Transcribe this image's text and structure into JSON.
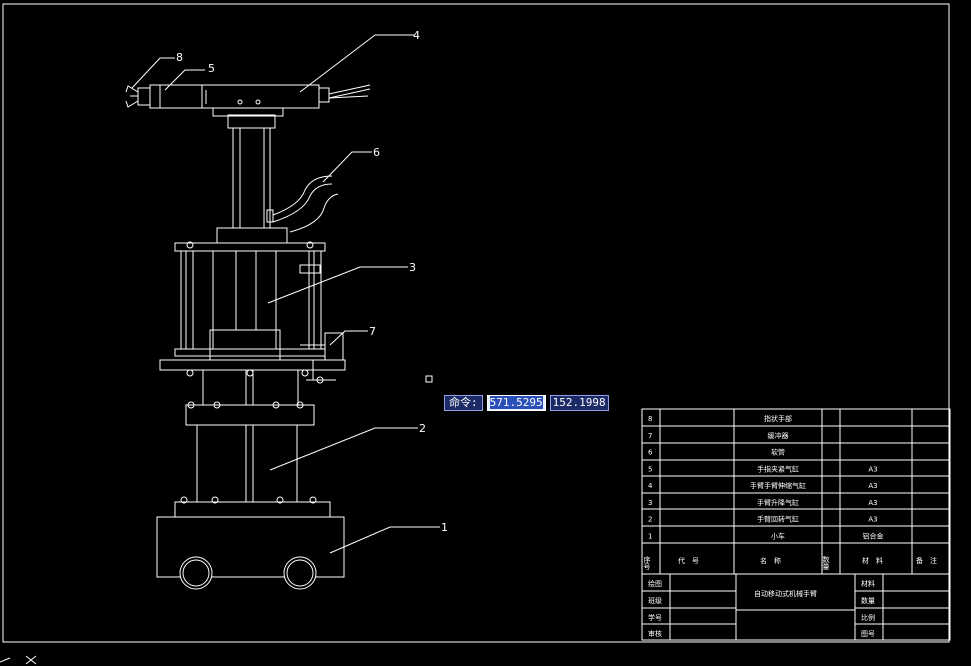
{
  "callouts": [
    "1",
    "2",
    "3",
    "4",
    "5",
    "6",
    "7",
    "8"
  ],
  "command": {
    "label": "命令:",
    "x_value": "571.5295",
    "y_value": "152.1998"
  },
  "parts": [
    {
      "no": "8",
      "code": "",
      "name": "指状手部",
      "qty": "",
      "material": "",
      "note": ""
    },
    {
      "no": "7",
      "code": "",
      "name": "缓冲器",
      "qty": "",
      "material": "",
      "note": ""
    },
    {
      "no": "6",
      "code": "",
      "name": "软管",
      "qty": "",
      "material": "",
      "note": ""
    },
    {
      "no": "5",
      "code": "",
      "name": "手指夹紧气缸",
      "qty": "",
      "material": "A3",
      "note": ""
    },
    {
      "no": "4",
      "code": "",
      "name": "手臂手臂伸缩气缸",
      "qty": "",
      "material": "A3",
      "note": ""
    },
    {
      "no": "3",
      "code": "",
      "name": "手臂升降气缸",
      "qty": "",
      "material": "A3",
      "note": ""
    },
    {
      "no": "2",
      "code": "",
      "name": "手臂回转气缸",
      "qty": "",
      "material": "A3",
      "note": ""
    },
    {
      "no": "1",
      "code": "",
      "name": "小车",
      "qty": "",
      "material": "铝合金",
      "note": ""
    }
  ],
  "parts_header": {
    "no": "序号",
    "code": "代　号",
    "name": "名　称",
    "qty": "数量",
    "material": "材　料",
    "note": "备　注"
  },
  "title_block": {
    "title": "自动移动式机械手臂",
    "left_labels": [
      "绘图",
      "班级",
      "学号",
      "审核"
    ],
    "right_labels": [
      "材料",
      "数量",
      "比例",
      "图号"
    ]
  },
  "colors": {
    "background": "#000000",
    "lines": "#ffffff",
    "command_bg": "#1c2a66",
    "highlight": "#2a4fb8"
  }
}
